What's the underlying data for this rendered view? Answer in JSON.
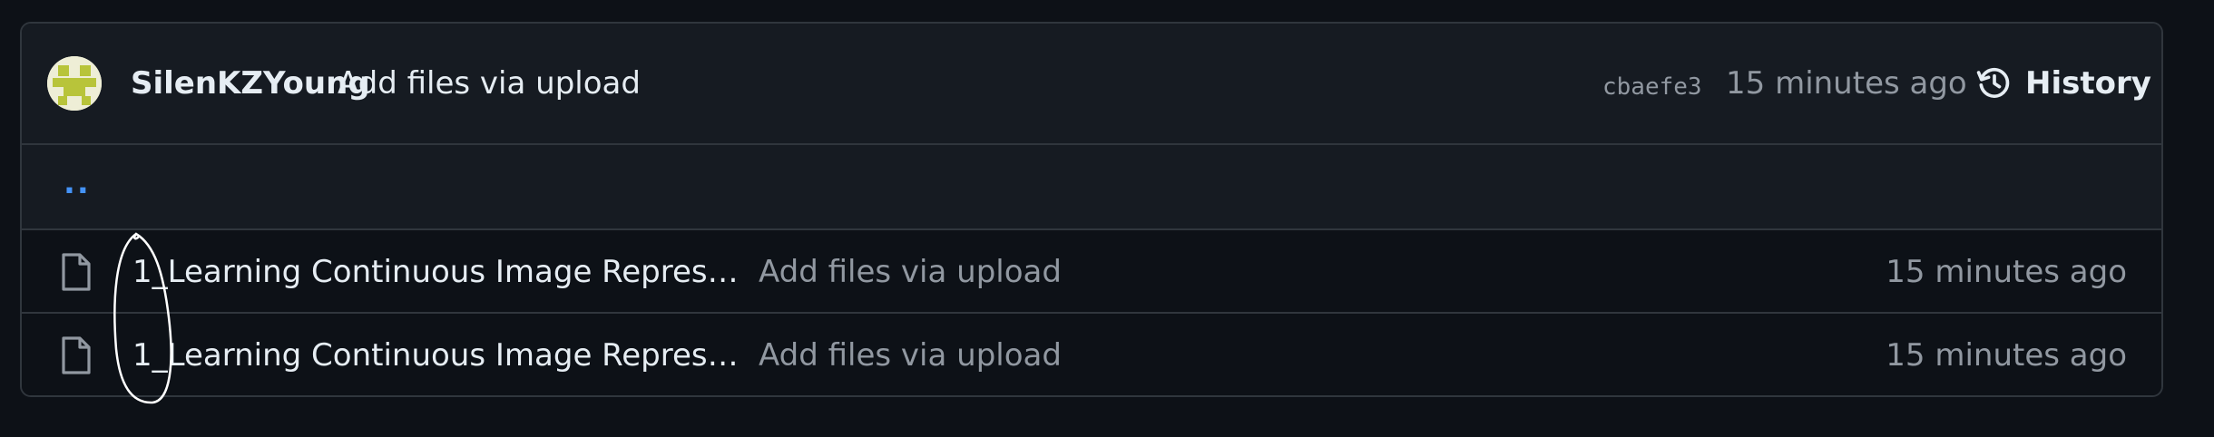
{
  "header": {
    "author": "SilenKZYoung",
    "commit_message": "Add files via upload",
    "commit_sha": "cbaefe3",
    "time": "15 minutes ago",
    "history_label": "History"
  },
  "parent_link": "..",
  "files": [
    {
      "name": "1_Learning Continuous Image Representation",
      "commit_message": "Add files via upload",
      "time": "15 minutes ago"
    },
    {
      "name": "1_Learning Continuous Image Representation",
      "commit_message": "Add files via upload",
      "time": "15 minutes ago"
    }
  ],
  "colors": {
    "background": "#0d1117",
    "header_bg": "#161b22",
    "border": "#30363d",
    "text": "#e6edf3",
    "muted": "#9198a1",
    "link": "#4493f8"
  },
  "icons": {
    "history": "history-icon",
    "file": "file-icon",
    "avatar": "avatar"
  }
}
